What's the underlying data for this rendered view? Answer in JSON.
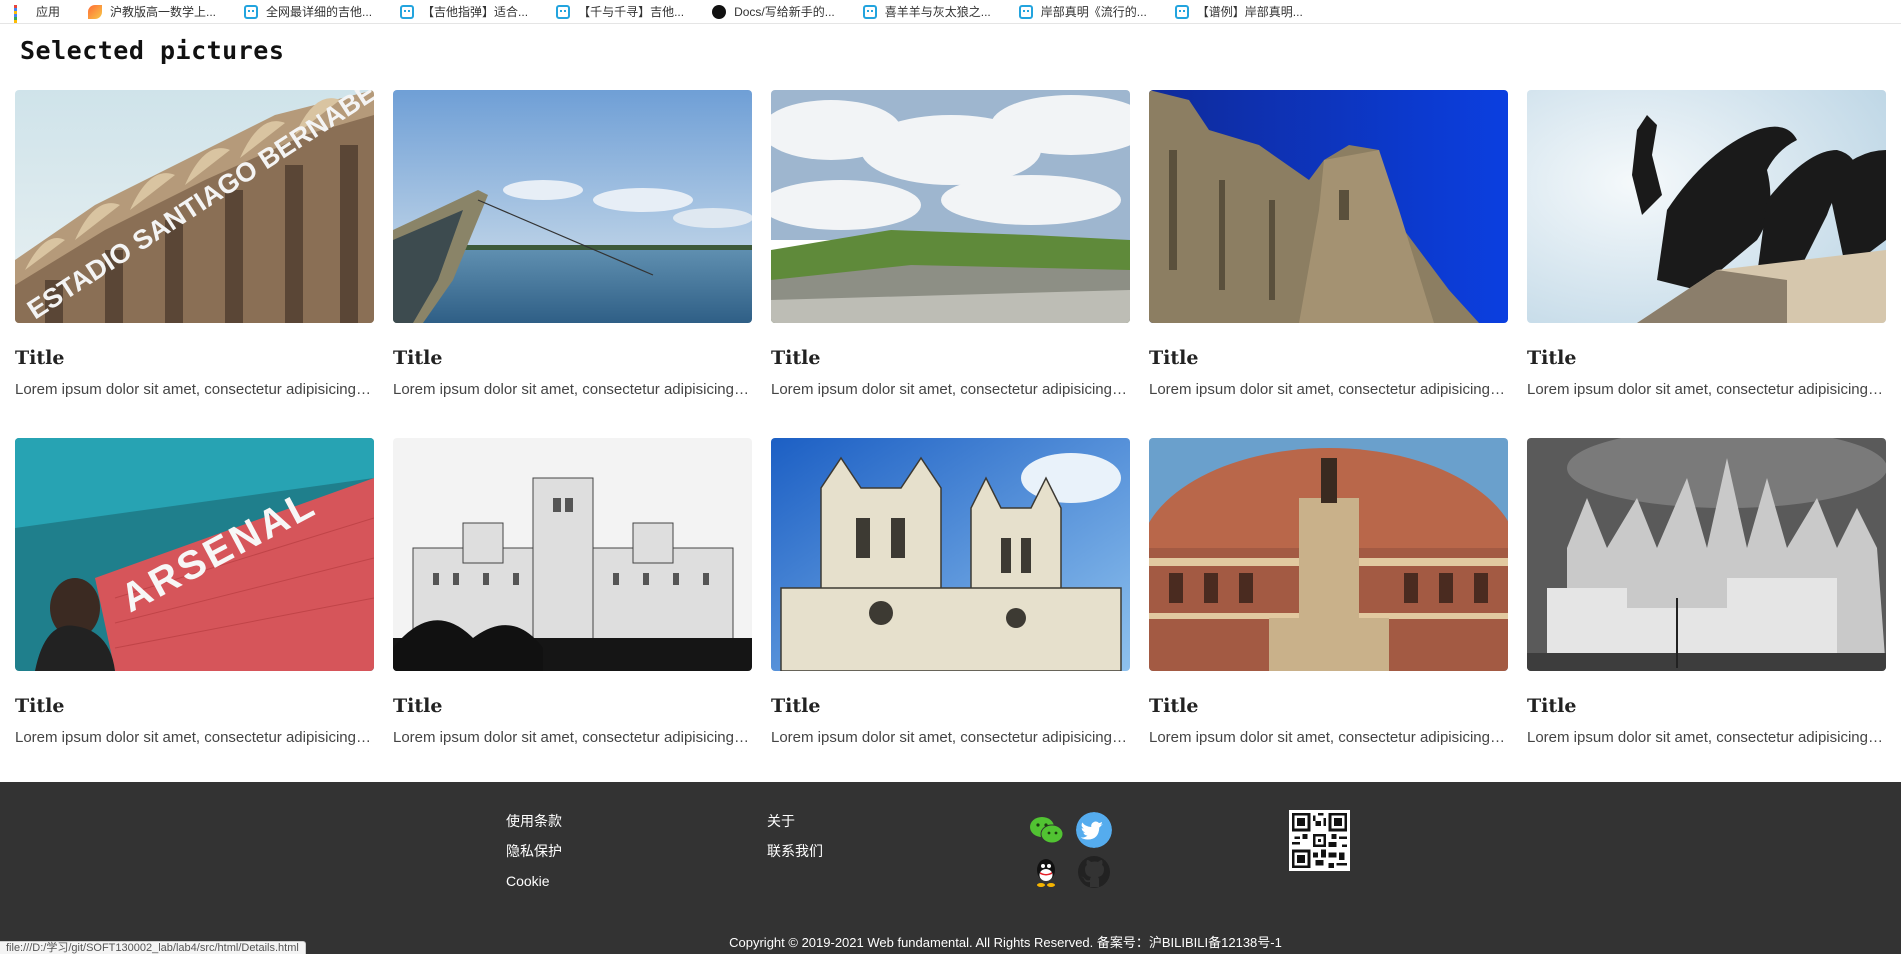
{
  "bookmarks": [
    {
      "icon": "apps-icon",
      "label": "应用"
    },
    {
      "icon": "leaf-icon",
      "label": "沪教版高一数学上..."
    },
    {
      "icon": "bilibili-icon",
      "label": "全网最详细的吉他..."
    },
    {
      "icon": "bilibili-icon",
      "label": "【吉他指弹】适合..."
    },
    {
      "icon": "bilibili-icon",
      "label": "【千与千寻】吉他..."
    },
    {
      "icon": "github-icon",
      "label": "Docs/写给新手的..."
    },
    {
      "icon": "bilibili-icon",
      "label": "喜羊羊与灰太狼之..."
    },
    {
      "icon": "bilibili-icon",
      "label": "岸部真明《流行的..."
    },
    {
      "icon": "bilibili-icon",
      "label": "【谱例】岸部真明..."
    }
  ],
  "page": {
    "title": "Selected pictures"
  },
  "gallery": [
    {
      "title": "Title",
      "desc": "Lorem ipsum dolor sit amet, consectetur adipisicing elit.",
      "photo": "stadium-photo",
      "sign": "ESTADIO SANTIAGO BERNABEU"
    },
    {
      "title": "Title",
      "desc": "Lorem ipsum dolor sit amet, consectetur adipisicing elit.",
      "photo": "boat-sea-photo",
      "sign": ""
    },
    {
      "title": "Title",
      "desc": "Lorem ipsum dolor sit amet, consectetur adipisicing elit.",
      "photo": "landscape-clouds-photo",
      "sign": ""
    },
    {
      "title": "Title",
      "desc": "Lorem ipsum dolor sit amet, consectetur adipisicing elit.",
      "photo": "castle-wall-photo",
      "sign": ""
    },
    {
      "title": "Title",
      "desc": "Lorem ipsum dolor sit amet, consectetur adipisicing elit.",
      "photo": "horse-statue-photo",
      "sign": ""
    },
    {
      "title": "Title",
      "desc": "Lorem ipsum dolor sit amet, consectetur adipisicing elit.",
      "photo": "arsenal-stadium-photo",
      "sign": "ARSENAL"
    },
    {
      "title": "Title",
      "desc": "Lorem ipsum dolor sit amet, consectetur adipisicing elit.",
      "photo": "palace-bw-photo",
      "sign": ""
    },
    {
      "title": "Title",
      "desc": "Lorem ipsum dolor sit amet, consectetur adipisicing elit.",
      "photo": "gothic-abbey-photo",
      "sign": ""
    },
    {
      "title": "Title",
      "desc": "Lorem ipsum dolor sit amet, consectetur adipisicing elit.",
      "photo": "royal-hall-photo",
      "sign": ""
    },
    {
      "title": "Title",
      "desc": "Lorem ipsum dolor sit amet, consectetur adipisicing elit.",
      "photo": "cathedral-bw-photo",
      "sign": ""
    }
  ],
  "footer": {
    "col1": [
      "使用条款",
      "隐私保护",
      "Cookie"
    ],
    "col2": [
      "关于",
      "联系我们"
    ],
    "social": [
      "wechat-icon",
      "twitter-icon",
      "qq-icon",
      "github-icon"
    ],
    "qr": "qr-code",
    "copyright": "Copyright © 2019-2021 Web fundamental. All Rights Reserved. 备案号：沪BILIBILI备12138号-1"
  },
  "status_url": "file:///D:/学习/git/SOFT130002_lab/lab4/src/html/Details.html",
  "colors": {
    "footer_bg": "#333333",
    "twitter": "#55acee",
    "wechat": "#51c332"
  }
}
